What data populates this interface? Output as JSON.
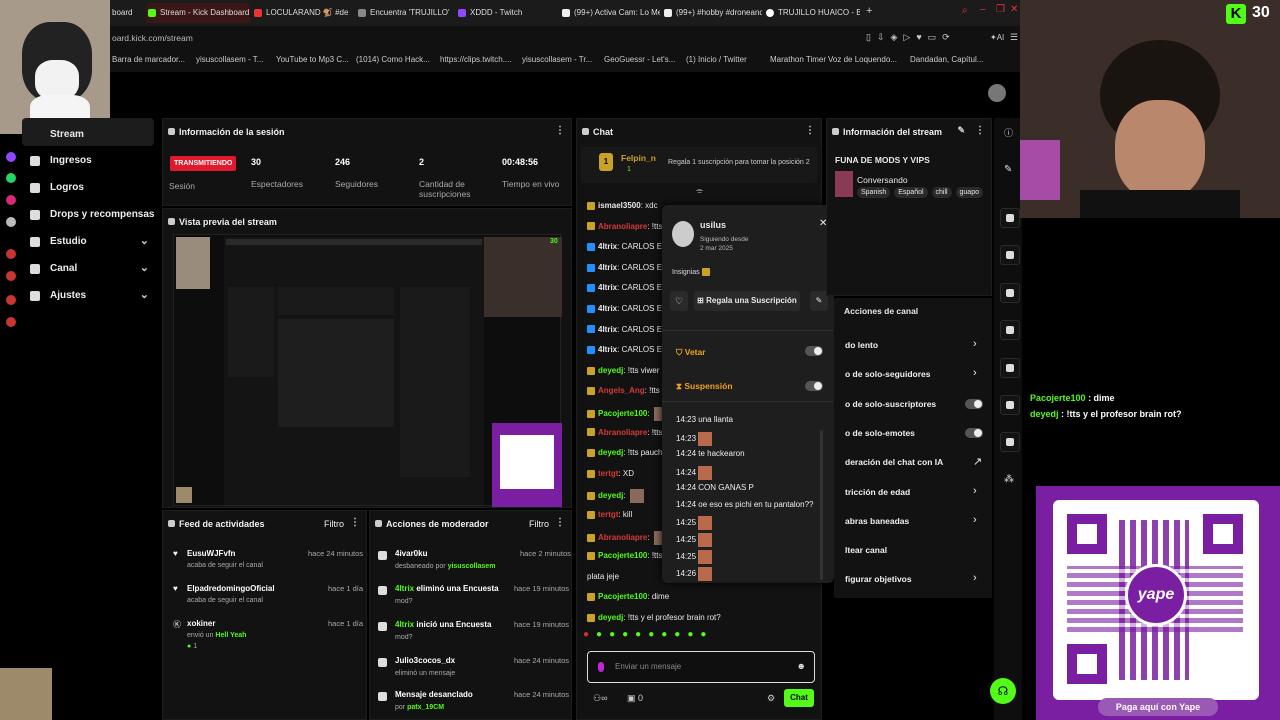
{
  "colors": {
    "brand": "#53fc18",
    "live": "#e0192d",
    "yape": "#7b1fa2"
  },
  "browser": {
    "tabs": [
      {
        "label": "Stream - Kick Dashboard",
        "active": true
      },
      {
        "label": "LOCULARAND 🐒 #de"
      },
      {
        "label": "Encuentra 'TRUJILLO' en"
      },
      {
        "label": "XDDD - Twitch"
      },
      {
        "label": "(99+) Activa Cam: Lo Mej"
      },
      {
        "label": "(99+) #hobby #droneando"
      },
      {
        "label": "TRUJILLO HUAICO - Busc"
      }
    ],
    "first_tab": "board",
    "url": "oard.kick.com/stream",
    "bookmarks": [
      "Barra de marcador...",
      "yisuscollasem - T...",
      "YouTube to Mp3 C...",
      "(1014) Como Hack...",
      "https://clips.twitch....",
      "yisuscollasem - Tr...",
      "GeoGuessr - Let's...",
      "(1) Inicio / Twitter",
      "Marathon Timer",
      "Voz de Loquendo...",
      "Dandadan, Capítul..."
    ]
  },
  "sidebar": {
    "items": [
      {
        "label": "Stream"
      },
      {
        "label": "Ingresos"
      },
      {
        "label": "Logros"
      },
      {
        "label": "Drops y recompensas"
      },
      {
        "label": "Estudio",
        "chevron": "⌄"
      },
      {
        "label": "Canal",
        "chevron": "⌄"
      },
      {
        "label": "Ajustes",
        "chevron": "⌄"
      }
    ]
  },
  "session": {
    "title": "Información de la sesión",
    "badge": "TRANSMITIENDO",
    "stats": [
      {
        "label": "Sesión",
        "value": ""
      },
      {
        "label": "Espectadores",
        "value": "30"
      },
      {
        "label": "Seguidores",
        "value": "246"
      },
      {
        "label": "Cantidad de suscripciones",
        "value": "2"
      },
      {
        "label": "Tiempo en vivo",
        "value": "00:48:56"
      }
    ]
  },
  "preview": {
    "title": "Vista previa del stream",
    "viewers": "30"
  },
  "feed": {
    "title": "Feed de actividades",
    "filter": "Filtro",
    "items": [
      {
        "name": "EusuWJFvfn",
        "sub": "acaba de seguir el canal",
        "time": "hace 24 minutos"
      },
      {
        "name": "ElpadredomingoOficial",
        "sub": "acaba de seguir el canal",
        "time": "hace 1 día"
      },
      {
        "name": "xokiner",
        "sub": "envió un",
        "sub2": "Hell Yeah",
        "amount": "1",
        "time": "hace 1 día"
      }
    ]
  },
  "modactions": {
    "title": "Acciones de moderador",
    "filter": "Filtro",
    "items": [
      {
        "name": "4ivar0ku",
        "sub": "desbaneado por",
        "by": "yisuscollasem",
        "time": "hace 2 minutos"
      },
      {
        "name": "4ltrix",
        "action": "eliminó una Encuesta",
        "sub": "mod?",
        "time": "hace 19 minutos"
      },
      {
        "name": "4ltrix",
        "action": "inició una Encuesta",
        "sub": "mod?",
        "time": "hace 19 minutos"
      },
      {
        "name": "Julio3cocos_dx",
        "sub": "eliminó un mensaje",
        "time": "hace 24 minutos"
      },
      {
        "name": "Mensaje desanclado",
        "sub": "por",
        "by": "patx_19CM",
        "time": "hace 24 minutos"
      }
    ]
  },
  "chat": {
    "title": "Chat",
    "pinned": {
      "user": "Felpin_n",
      "rank": "1",
      "count": "1",
      "text": "Regala 1 suscripción para tomar la posición 2"
    },
    "messages": [
      {
        "user": "ismael3500",
        "text": "xdc",
        "color": "#e8e8e8"
      },
      {
        "user": "Abranoliapre",
        "text": "!tts",
        "color": "#d43a3a"
      },
      {
        "user": "4ltrix",
        "text": "CARLOS E",
        "color": "#e8e8e8"
      },
      {
        "user": "4ltrix",
        "text": "CARLOS E",
        "color": "#e8e8e8"
      },
      {
        "user": "4ltrix",
        "text": "CARLOS E",
        "color": "#e8e8e8"
      },
      {
        "user": "4ltrix",
        "text": "CARLOS E",
        "color": "#e8e8e8"
      },
      {
        "user": "4ltrix",
        "text": "CARLOS E",
        "color": "#e8e8e8"
      },
      {
        "user": "4ltrix",
        "text": "CARLOS E",
        "color": "#e8e8e8"
      },
      {
        "user": "deyedj",
        "text": "!tts viwer de",
        "color": "#53fc18"
      },
      {
        "user": "Angels_Ang",
        "text": "!tts",
        "color": "#d43a3a"
      },
      {
        "user": "Pacojerte100",
        "text": "",
        "color": "#53fc18"
      },
      {
        "user": "Abranoliapre",
        "text": "!tts",
        "color": "#d43a3a"
      },
      {
        "user": "deyedj",
        "text": "!tts pauchiki",
        "color": "#53fc18"
      },
      {
        "user": "tertgt",
        "text": "XD",
        "color": "#d43a3a"
      },
      {
        "user": "deyedj",
        "text": "",
        "color": "#53fc18"
      },
      {
        "user": "tertgt",
        "text": "kill",
        "color": "#d43a3a"
      },
      {
        "user": "Abranoliapre",
        "text": "",
        "color": "#d43a3a"
      },
      {
        "user": "Pacojerte100",
        "text": "!tts oy",
        "color": "#53fc18"
      },
      {
        "user": "",
        "text": "plata jeje",
        "color": "#e8e8e8"
      },
      {
        "user": "Pacojerte100",
        "text": "dime",
        "color": "#53fc18"
      },
      {
        "user": "deyedj",
        "text": "!tts y el profesor brain rot?",
        "color": "#53fc18"
      }
    ],
    "input_placeholder": "Enviar un mensaje",
    "send_label": "Chat",
    "points": "0"
  },
  "usercard": {
    "name": "usilus",
    "since_label": "Siguiendo desde",
    "since": "2 mar 2025",
    "badges_label": "Insignias",
    "gift_label": "Regala una Suscripción",
    "ban_label": "Vetar",
    "timeout_label": "Suspensión",
    "history": [
      {
        "time": "14:23",
        "text": "una llanta"
      },
      {
        "time": "14:23",
        "text": ""
      },
      {
        "time": "14:24",
        "text": "te hackearon"
      },
      {
        "time": "14:24",
        "text": ""
      },
      {
        "time": "14:24",
        "text": "CON GANAS P"
      },
      {
        "time": "14:24",
        "text": "oe eso es pichi en tu pantalon??"
      },
      {
        "time": "14:25",
        "text": ""
      },
      {
        "time": "14:25",
        "text": ""
      },
      {
        "time": "14:25",
        "text": ""
      },
      {
        "time": "14:26",
        "text": ""
      }
    ]
  },
  "streaminfo": {
    "title": "Información del stream",
    "stream_title": "FUNA DE MODS Y VIPS",
    "category": "Conversando",
    "tags": [
      "Spanish",
      "Español",
      "chill",
      "guapo"
    ]
  },
  "channel_actions": {
    "title": "Acciones de canal",
    "items": [
      {
        "label": "do lento",
        "control": "›"
      },
      {
        "label": "o de solo-seguidores",
        "control": "›"
      },
      {
        "label": "o de solo-suscriptores",
        "control": "toggle"
      },
      {
        "label": "o de solo-emotes",
        "control": "toggle"
      },
      {
        "label": "deración del chat con IA",
        "control": "↗"
      },
      {
        "label": "tricción de edad",
        "control": "›"
      },
      {
        "label": "abras baneadas",
        "control": "›"
      },
      {
        "label": "ltear canal",
        "control": ""
      },
      {
        "label": "figurar objetivos",
        "control": "›"
      }
    ]
  },
  "overlay": {
    "kick_viewers": "30",
    "chat": [
      {
        "user": "Pacojerte100",
        "text": ": dime"
      },
      {
        "user": "deyedj",
        "text": ": !tts y el profesor brain rot?"
      }
    ],
    "yape_logo": "yape",
    "yape_caption": "Paga aquí con Yape"
  }
}
